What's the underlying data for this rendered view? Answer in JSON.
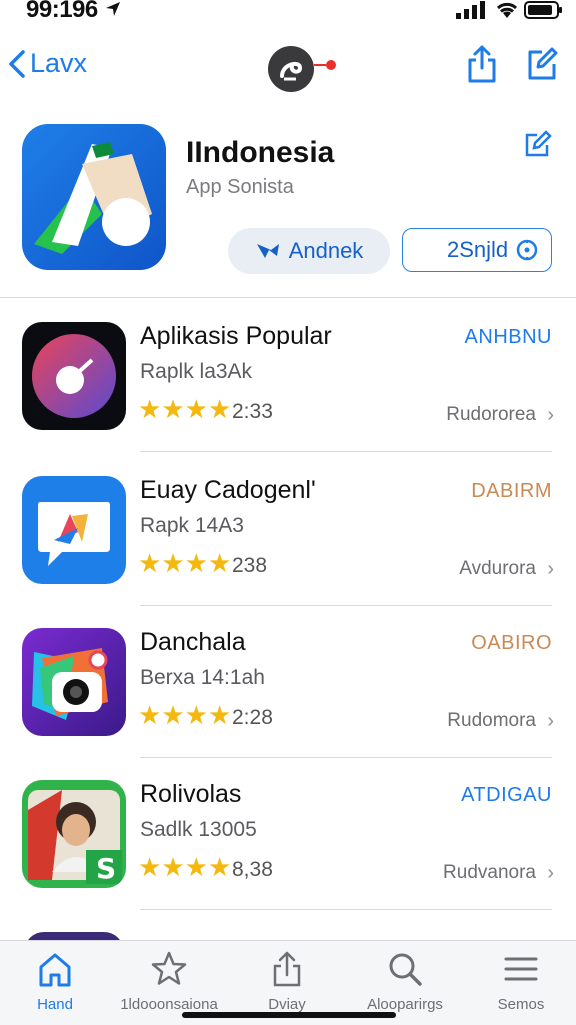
{
  "status_bar": {
    "time": "99:196"
  },
  "nav": {
    "back_label": "Lavx"
  },
  "hero": {
    "title": "IIndonesia",
    "subtitle": "App Sonista",
    "primary_button": "Andnek",
    "secondary_button": "2Snjld"
  },
  "apps": [
    {
      "title": "Aplikasis Popular",
      "subtitle": "Raplk la3Ak",
      "rating": "2:33",
      "category": "ANHBNU",
      "category_color": "#1e7bea",
      "more": "Rudororea",
      "stars": 4.5
    },
    {
      "title": "Euay Cadogenl'",
      "subtitle": "Rapk 14A3",
      "rating": "238",
      "category": "DABIRM",
      "category_color": "#c98a55",
      "more": "Avdurora",
      "stars": 4
    },
    {
      "title": "Danchala",
      "subtitle": "Berxa 14:1ah",
      "rating": "2:28",
      "category": "OABIRO",
      "category_color": "#c98a55",
      "more": "Rudomora",
      "stars": 4.5
    },
    {
      "title": "Rolivolas",
      "subtitle": "Sadlk 13005",
      "rating": "8,38",
      "category": "ATDIGAU",
      "category_color": "#1e7bea",
      "more": "Rudvanora",
      "stars": 4.5
    }
  ],
  "tabs": [
    {
      "label": "Hand",
      "icon": "home-icon",
      "active": true
    },
    {
      "label": "1ldooonsaiona",
      "icon": "star-icon",
      "active": false
    },
    {
      "label": "Dviay",
      "icon": "share-icon",
      "active": false
    },
    {
      "label": "Alooparirgs",
      "icon": "search-icon",
      "active": false
    },
    {
      "label": "Semos",
      "icon": "menu-icon",
      "active": false
    }
  ],
  "colors": {
    "accent": "#1e7bea",
    "star": "#f5b80f"
  }
}
